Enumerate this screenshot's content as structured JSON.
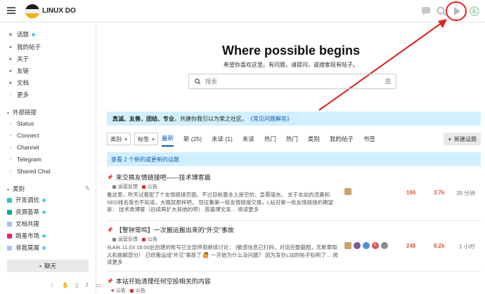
{
  "header": {
    "site_name": "LINUX DO"
  },
  "sidebar": {
    "items": [
      {
        "label": "话题",
        "icon": "layers-icon",
        "dot": true
      },
      {
        "label": "我的帖子",
        "icon": "user-icon"
      },
      {
        "label": "关于",
        "icon": "user-icon"
      },
      {
        "label": "友链",
        "icon": "user-icon"
      },
      {
        "label": "文档",
        "icon": "user-icon"
      },
      {
        "label": "更多",
        "icon": "ellipsis-icon"
      }
    ],
    "external_title": "外部链接",
    "external": [
      {
        "label": "Status"
      },
      {
        "label": "Connect"
      },
      {
        "label": "Channel"
      },
      {
        "label": "Telegram"
      },
      {
        "label": "Shared Chat"
      }
    ],
    "category_title": "类别",
    "categories": [
      {
        "label": "开发调优",
        "color": "#32c3c3",
        "dot": true
      },
      {
        "label": "资源荟萃",
        "color": "#12a89d",
        "dot": true
      },
      {
        "label": "文档共建",
        "color": "#9ec2f8"
      },
      {
        "label": "跳蚤市场",
        "color": "#ed207b",
        "dot": true
      },
      {
        "label": "非我莫属",
        "color": "#a8c6fe",
        "dot": true
      }
    ],
    "chat_label": "聊天"
  },
  "hero": {
    "title": "Where possible begins",
    "subtitle": "希望你喜欢这里。有问题，请提问，或搜索现有帖子。",
    "search_placeholder": "搜索"
  },
  "banner": {
    "bold": "真诚、友善、团结、专业",
    "text": "，共建你我引以为荣之社区。",
    "link": "《常见问题解答》"
  },
  "nav": {
    "category_dd": "类别",
    "tag_dd": "标签",
    "tabs": [
      "最新",
      "新 (25)",
      "未读 (1)",
      "未读",
      "热门",
      "热门",
      "类别",
      "我的帖子",
      "书签"
    ],
    "new_topic": "新建话题"
  },
  "new_topics_bar": "查看 2 个新的或更新的话题",
  "topics": [
    {
      "title": "来交换友情链接吧——技术博客篇",
      "cats": [
        {
          "label": "运营反馈",
          "color": "#808281"
        },
        {
          "label": "公告",
          "color": "#d93030"
        }
      ],
      "excerpt": "看这里，昨天试着配了个友情链接页面。不过目前基本上是空的，急需填充。 关于本站的流量和SEO排名我也不知道，大概就那样吧。 现征集第一批友情链接交换，L站对第一批友情链接的期望是： 技术类博客（后续再扩大其他的吧） 首篇博文发… 阅读更多",
      "replies": "166",
      "views": "3.7k",
      "activity": "39 分钟"
    },
    {
      "title": "【警钟常鸣】一次搬运搬出来的“外交”事故",
      "cats": [
        {
          "label": "运营反馈",
          "color": "#808281"
        },
        {
          "label": "公告",
          "color": "#d93030"
        }
      ],
      "excerpt": "从AIK 11.03 18:00后创建的账号已全部停用继续讨论： (敏感信息已打码，对话完整截图，无断章取义和曲解部分） 已经搬运成“外交”事故了 🙋 一开始为什么没问题？ 因为发在L站的帖子标明了… 阅读更多",
      "replies": "248",
      "views": "8.2k",
      "activity": "1 小时"
    },
    {
      "title": "本站开始清理任何空投相关的内容",
      "cats": [
        {
          "label": "公告",
          "color": "#d93030"
        },
        {
          "label": "公告",
          "color": "#d93030"
        }
      ],
      "excerpt": "",
      "replies": "",
      "views": "",
      "activity": ""
    }
  ],
  "colors": {
    "accent": "#0a5cb8",
    "orange": "#e45735",
    "annotation": "#e01e1e"
  }
}
